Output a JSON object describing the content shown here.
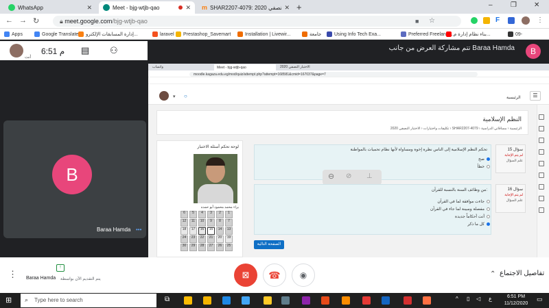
{
  "browser": {
    "tabs": [
      {
        "title": "WhatsApp",
        "color": "#25d366"
      },
      {
        "title": "Meet - bjg-wtjb-qao",
        "color": "#00897b"
      },
      {
        "title": "SHAR2207-4079: 2020 الاختبار النصفي",
        "color": "#f98012"
      }
    ],
    "new_tab": "+",
    "win_min": "–",
    "win_max": "❐",
    "win_close": "✕",
    "url_host": "meet.google.com",
    "url_path": "/bjg-wtjb-qao",
    "bookmarks": [
      {
        "label": "Apps",
        "color": "#4285f4"
      },
      {
        "label": "Google Translate",
        "color": "#4285f4"
      },
      {
        "label": "إدارة المسابقات الإلكترو...",
        "color": "#f98012"
      },
      {
        "label": "laravel",
        "color": "#f4511e"
      },
      {
        "label": "Prestashop_Savemart",
        "color": "#f4b400"
      },
      {
        "label": "Installation | Livewir...",
        "color": "#ef6c00"
      },
      {
        "label": "جامعة",
        "color": "#ef6c00"
      },
      {
        "label": "Using Info Tech Exa...",
        "color": "#3949ab"
      },
      {
        "label": "Preferred Freelance...",
        "color": "#5c6bc0"
      },
      {
        "label": "بناء نظام إدارة م...",
        "color": "#ff0000"
      },
      {
        "label": "09-",
        "color": "#333333"
      }
    ]
  },
  "meet": {
    "clock": "6:51 م",
    "self_label": "أنت",
    "presenting_notice": "تتم مشاركة العرض من جانب Baraa Hamda",
    "presenter_initial": "B",
    "participant_name": "Baraa Hamda",
    "participant_initial": "B",
    "footer_name": "Baraa Hamda",
    "footer_sub": "يتم التقديم الآن بواسطة",
    "meeting_details": "تفاصيل الاجتماع",
    "colors": {
      "avatar": "#e8467b",
      "end_call": "#ea4335"
    }
  },
  "shared": {
    "tabs": [
      "واتساب",
      "Meet - bjg-wtjb-qao",
      "الاختبار النصفي 2020"
    ],
    "url": "moodle.kagaza.edu.eg/mod/quiz/attempt.php?attempt=168581&cmid=167037&page=7",
    "home_label": "الرئيسية",
    "course_title": "النظم الإسلامية",
    "breadcrumb": [
      "الرئيسية",
      "مساقاتي الدراسية",
      "SHAR2207-4079",
      "تكليفات واختبارات",
      "الاختبار النصفي 2020"
    ],
    "nav_title": "لوحة تحكم أسئلة الاختبار",
    "student_name": "براء محمد محمود أبو حمده",
    "nav_numbers": [
      "1",
      "2",
      "3",
      "4",
      "5",
      "6",
      "7",
      "8",
      "9",
      "10",
      "11",
      "12",
      "13",
      "14",
      "15",
      "16",
      "17",
      "18",
      "19",
      "20",
      "21",
      "22",
      "23",
      "24",
      "25",
      "26",
      "27",
      "28",
      "29",
      "30"
    ],
    "q15": {
      "label": "سؤال 15",
      "status": "لم يتم الإجابة",
      "flag": "علم السؤال",
      "text": "تحكم النظم الإسلامية إلى الناس نظرة إخوة ومساواة لأنها نظام تحميات بالمواطنة",
      "options": [
        "صح",
        "خطأ"
      ]
    },
    "q16": {
      "label": "سؤال 16",
      "status": "لم يتم الإجابة",
      "flag": "علم السؤال",
      "text": "من وظائف السنة بالنسبة للقرآن:",
      "options": [
        "جاءت موافقة لما في القرآن",
        "مفصلة ومبينة لما جاء في القرآن",
        "أتت أحكاماً جديدة",
        "كل ما ذكر"
      ]
    },
    "next_button": "الصفحة التالية"
  },
  "taskbar": {
    "search_placeholder": "Type here to search",
    "time": "6:51 PM",
    "date": "11/12/2020",
    "lang": "ع"
  }
}
